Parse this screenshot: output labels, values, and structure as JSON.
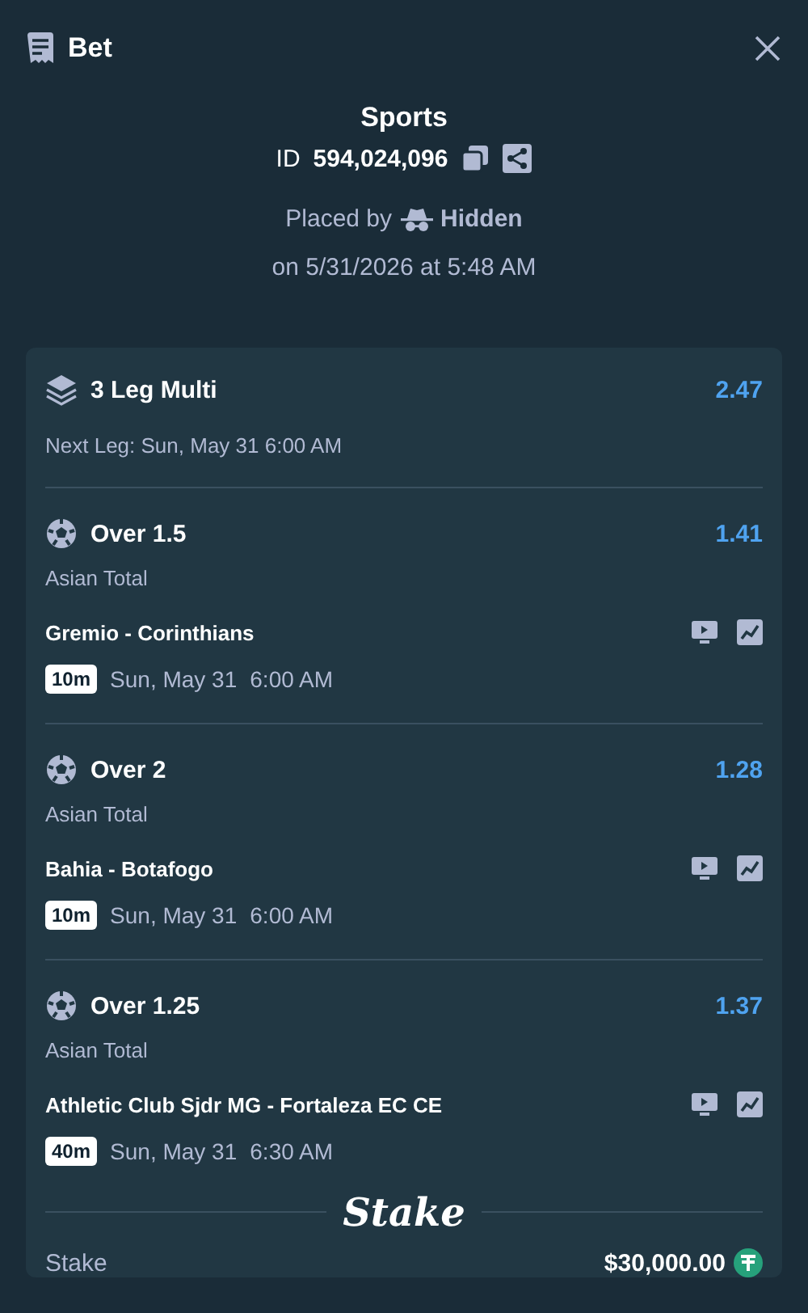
{
  "header": {
    "title": "Bet"
  },
  "summary": {
    "category": "Sports",
    "id_label": "ID",
    "id_value": "594,024,096",
    "placed_by_label": "Placed by",
    "placed_by_user": "Hidden",
    "placed_on": "on 5/31/2026 at 5:48 AM"
  },
  "multi": {
    "title": "3 Leg Multi",
    "odds": "2.47",
    "next_leg": "Next Leg: Sun, May 31 6:00 AM"
  },
  "legs": [
    {
      "selection": "Over 1.5",
      "odds": "1.41",
      "market": "Asian Total",
      "match": "Gremio - Corinthians",
      "badge": "10m",
      "date": "Sun, May 31",
      "time": "6:00 AM"
    },
    {
      "selection": "Over 2",
      "odds": "1.28",
      "market": "Asian Total",
      "match": "Bahia - Botafogo",
      "badge": "10m",
      "date": "Sun, May 31",
      "time": "6:00 AM"
    },
    {
      "selection": "Over 1.25",
      "odds": "1.37",
      "market": "Asian Total",
      "match": "Athletic Club Sjdr MG - Fortaleza EC CE",
      "badge": "40m",
      "date": "Sun, May 31",
      "time": "6:30 AM"
    }
  ],
  "brand": "Stake",
  "stake_row": {
    "label": "Stake",
    "amount": "$30,000.00"
  }
}
